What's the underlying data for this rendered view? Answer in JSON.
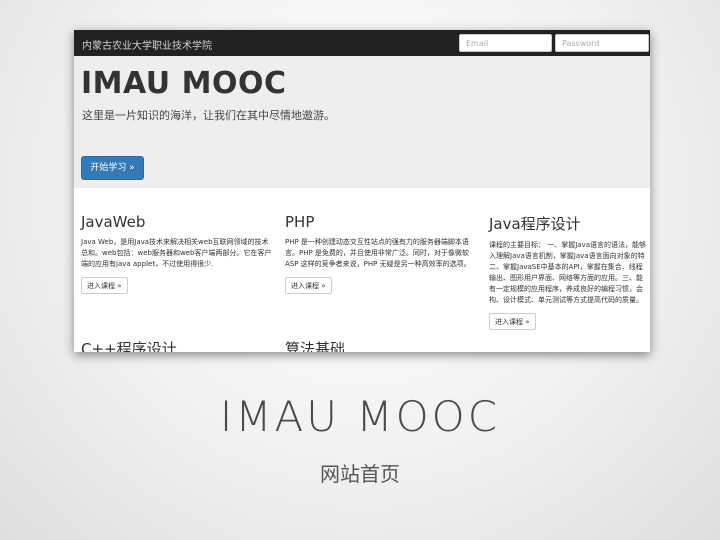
{
  "navbar": {
    "brand": "内蒙古农业大学职业技术学院",
    "email_placeholder": "Email",
    "password_placeholder": "Password"
  },
  "jumbotron": {
    "title": "IMAU MOOC",
    "subtitle": "这里是一片知识的海洋，让我们在其中尽情地遨游。",
    "button_label": "开始学习 »"
  },
  "courses": [
    {
      "title": "JavaWeb",
      "description": "Java Web，是用Java技术来解决相关web互联网领域的技术总和。web包括：web服务器和web客户端两部分。它在客户端的应用有java applet，不过使用得很少.",
      "button_label": "进入课程 »"
    },
    {
      "title": "PHP",
      "description": "PHP 是一种创建动态交互性站点的强有力的服务器端脚本语言。PHP 是免费的，并且使用非常广泛。同时，对于像微软 ASP 这样的竞争者来说，PHP 无疑是另一种高效率的选项。",
      "button_label": "进入课程 »"
    },
    {
      "title": "Java程序设计",
      "description_lines": [
        "课程的主要目标： 一、掌握Java语言的语法，能够",
        "入理解Java语言机制，掌握Java语言面向对象的特",
        "二、掌握JavaSE中基本的API，掌握在集合、线程",
        "输出、图形用户界面、网络等方面的应用。三、能",
        "有一定规模的应用程序，养成良好的编程习惯，会",
        "构、设计模式、单元测试等方式提高代码的质量。"
      ],
      "button_label": "进入课程 »"
    },
    {
      "title": "C++程序设计"
    },
    {
      "title": "算法基础"
    }
  ],
  "slide": {
    "title": "IMAU MOOC",
    "subtitle": "网站首页"
  }
}
